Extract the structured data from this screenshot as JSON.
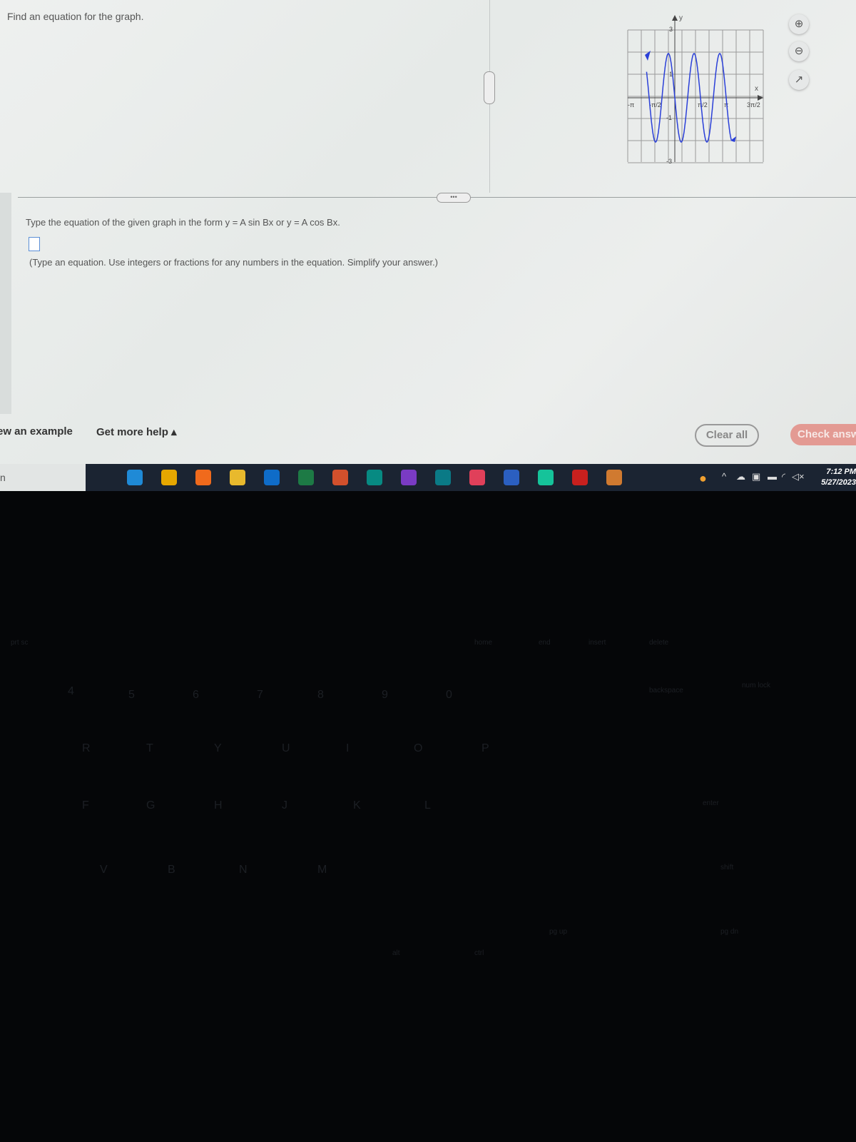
{
  "question": {
    "title": "Find an equation for the graph.",
    "instruction": "Type the equation of the given graph in the form y = A sin Bx or y = A cos Bx.",
    "hint": "(Type an equation. Use integers or fractions for any numbers in the equation. Simplify your answer.)",
    "answer_value": "",
    "more_label": "•••"
  },
  "graph": {
    "x_axis_label": "x",
    "y_axis_label": "y",
    "x_ticks": [
      "-π",
      "-π/2",
      "π/2",
      "π",
      "3π/2"
    ],
    "y_ticks": [
      "3",
      "1",
      "-1",
      "-3"
    ],
    "curve_color": "#2a3fd8",
    "amplitude": 2,
    "period": "π/2"
  },
  "tools": {
    "zoom_in": "zoom-in",
    "zoom_out": "zoom-out",
    "popout": "external-link"
  },
  "footer": {
    "example_label": "ew an example",
    "help_label": "Get more help ▴",
    "clear_label": "Clear all",
    "check_label": "Check answ"
  },
  "taskbar": {
    "search_text": "n",
    "apps": [
      "task-view",
      "edge",
      "chrome",
      "firefox",
      "file-explorer",
      "outlook",
      "excel",
      "powerpoint",
      "publisher",
      "onenote",
      "sway",
      "creative-cloud",
      "word",
      "grammarly",
      "acrobat",
      "teams"
    ],
    "time": "7:12 PM",
    "date": "5/27/2023"
  },
  "keyboard": {
    "keys": [
      "4",
      "5",
      "6",
      "7",
      "8",
      "9",
      "0",
      "R",
      "T",
      "Y",
      "U",
      "I",
      "O",
      "P",
      "F",
      "G",
      "H",
      "J",
      "K",
      "L",
      "V",
      "B",
      "N",
      "M",
      "backspace",
      "enter",
      "shift",
      "alt",
      "ctrl",
      "pg up",
      "pg dn",
      "num lock",
      "home",
      "end",
      "insert",
      "delete",
      "prt sc"
    ]
  },
  "colors": {
    "accent_check": "#e39a93",
    "taskbar": "#1b2432"
  }
}
